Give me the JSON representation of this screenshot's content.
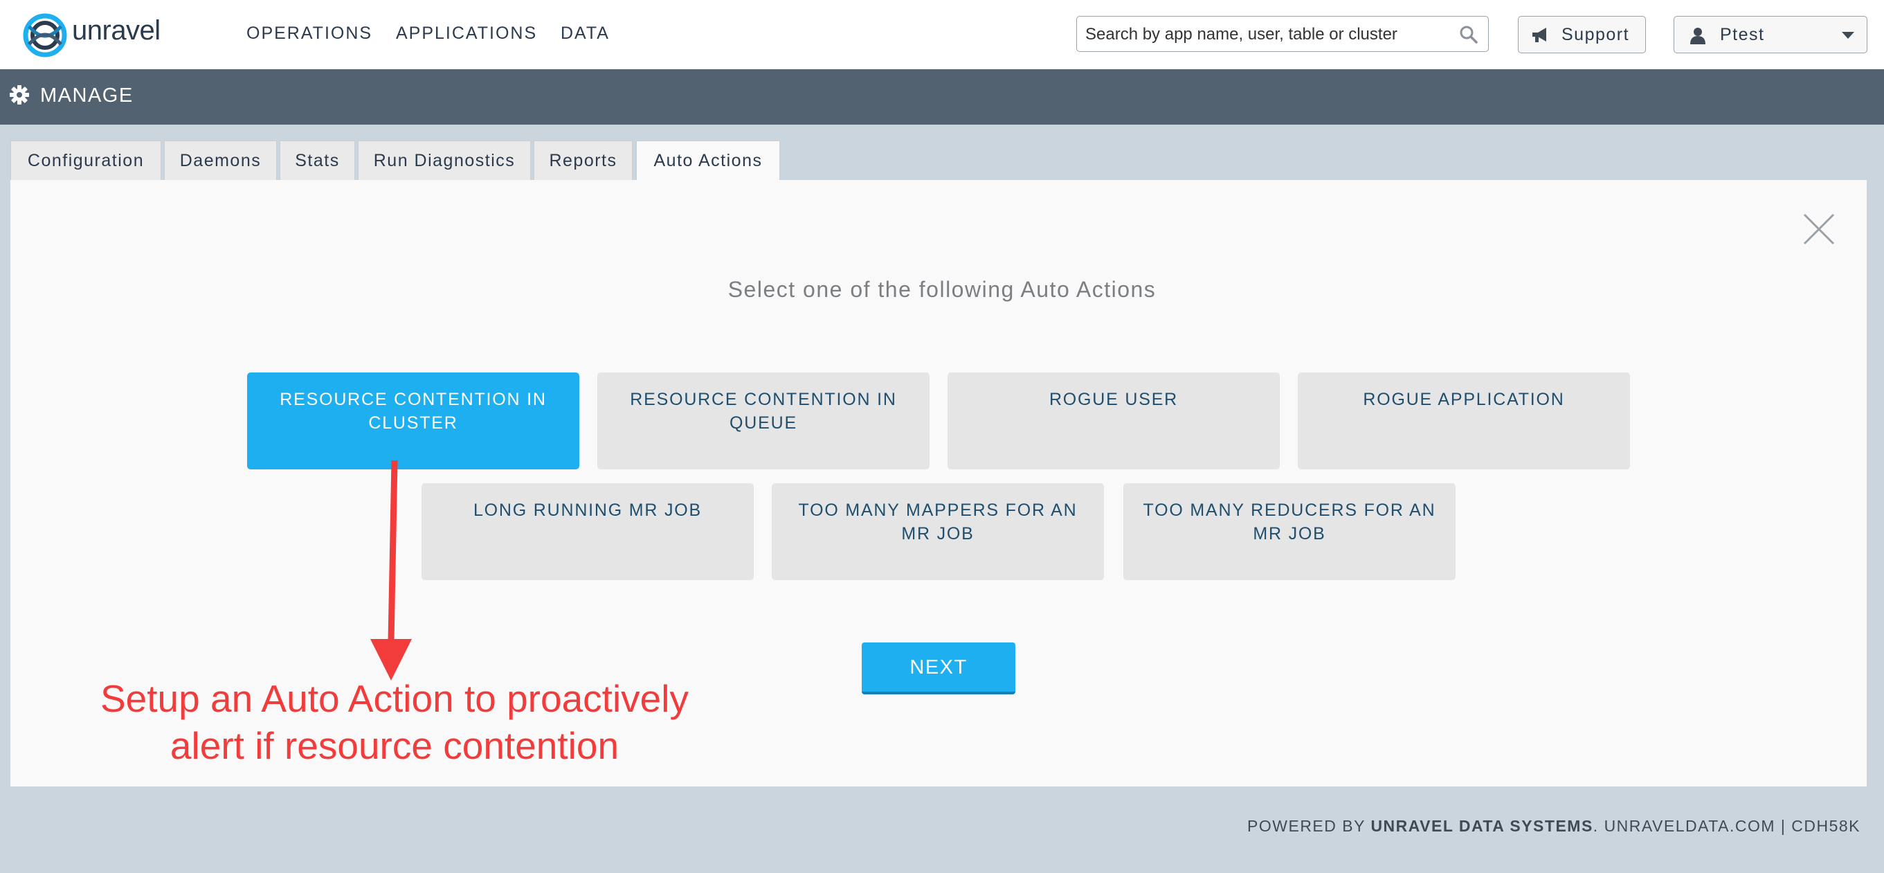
{
  "brand": {
    "name": "unravel"
  },
  "nav": [
    {
      "label": "OPERATIONS"
    },
    {
      "label": "APPLICATIONS"
    },
    {
      "label": "DATA"
    }
  ],
  "search": {
    "placeholder": "Search by app name, user, table or cluster",
    "value": ""
  },
  "support": {
    "label": "Support"
  },
  "user": {
    "name": "Ptest"
  },
  "manage": {
    "title": "MANAGE"
  },
  "tabs": [
    {
      "label": "Configuration"
    },
    {
      "label": "Daemons"
    },
    {
      "label": "Stats"
    },
    {
      "label": "Run Diagnostics"
    },
    {
      "label": "Reports"
    },
    {
      "label": "Auto Actions",
      "active": true
    }
  ],
  "panel": {
    "prompt": "Select one of the following Auto Actions",
    "options": [
      {
        "label": "RESOURCE CONTENTION IN CLUSTER",
        "selected": true
      },
      {
        "label": "RESOURCE CONTENTION IN QUEUE",
        "selected": false
      },
      {
        "label": "ROGUE USER",
        "selected": false
      },
      {
        "label": "ROGUE APPLICATION",
        "selected": false
      },
      {
        "label": "LONG RUNNING MR JOB",
        "selected": false
      },
      {
        "label": "TOO MANY MAPPERS FOR AN MR JOB",
        "selected": false
      },
      {
        "label": "TOO MANY REDUCERS FOR AN MR JOB",
        "selected": false
      }
    ],
    "next_label": "NEXT"
  },
  "annotation": {
    "line1": "Setup an Auto Action to proactively",
    "line2": "alert if resource contention"
  },
  "footer": {
    "prefix": "POWERED BY ",
    "company": "UNRAVEL DATA SYSTEMS",
    "suffix": ". UNRAVELDATA.COM | CDH58K"
  },
  "colors": {
    "accent": "#1daff0",
    "manage_bar": "#536270",
    "annotation": "#f23b3b"
  }
}
